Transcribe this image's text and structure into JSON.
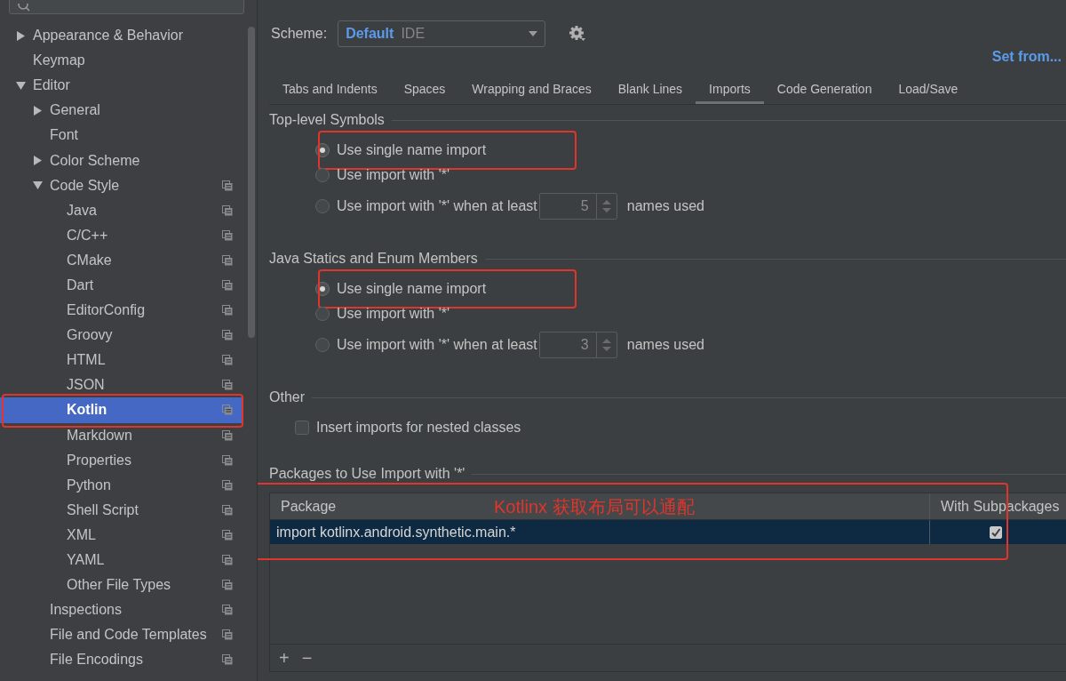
{
  "sidebar": {
    "tree": [
      {
        "label": "Appearance & Behavior",
        "expanded": false,
        "selected": false,
        "scoped": false,
        "annotated": false
      },
      {
        "label": "Keymap",
        "selected": false,
        "scoped": false,
        "annotated": false
      },
      {
        "label": "Editor",
        "expanded": true,
        "selected": false,
        "scoped": false,
        "annotated": false,
        "children": [
          {
            "label": "General",
            "expanded": false,
            "selected": false,
            "scoped": false,
            "annotated": false
          },
          {
            "label": "Font",
            "selected": false,
            "scoped": false,
            "annotated": false
          },
          {
            "label": "Color Scheme",
            "expanded": false,
            "selected": false,
            "scoped": false,
            "annotated": false
          },
          {
            "label": "Code Style",
            "expanded": true,
            "selected": false,
            "scoped": true,
            "annotated": false,
            "children": [
              {
                "label": "Java",
                "selected": false,
                "scoped": true,
                "annotated": false
              },
              {
                "label": "C/C++",
                "selected": false,
                "scoped": true,
                "annotated": false
              },
              {
                "label": "CMake",
                "selected": false,
                "scoped": true,
                "annotated": false
              },
              {
                "label": "Dart",
                "selected": false,
                "scoped": true,
                "annotated": false
              },
              {
                "label": "EditorConfig",
                "selected": false,
                "scoped": true,
                "annotated": false
              },
              {
                "label": "Groovy",
                "selected": false,
                "scoped": true,
                "annotated": false
              },
              {
                "label": "HTML",
                "selected": false,
                "scoped": true,
                "annotated": false
              },
              {
                "label": "JSON",
                "selected": false,
                "scoped": true,
                "annotated": false
              },
              {
                "label": "Kotlin",
                "selected": true,
                "scoped": true,
                "annotated": true
              },
              {
                "label": "Markdown",
                "selected": false,
                "scoped": true,
                "annotated": false
              },
              {
                "label": "Properties",
                "selected": false,
                "scoped": true,
                "annotated": false
              },
              {
                "label": "Python",
                "selected": false,
                "scoped": true,
                "annotated": false
              },
              {
                "label": "Shell Script",
                "selected": false,
                "scoped": true,
                "annotated": false
              },
              {
                "label": "XML",
                "selected": false,
                "scoped": true,
                "annotated": false
              },
              {
                "label": "YAML",
                "selected": false,
                "scoped": true,
                "annotated": false
              },
              {
                "label": "Other File Types",
                "selected": false,
                "scoped": true,
                "annotated": false
              }
            ]
          },
          {
            "label": "Inspections",
            "selected": false,
            "scoped": true,
            "annotated": false
          },
          {
            "label": "File and Code Templates",
            "selected": false,
            "scoped": true,
            "annotated": false
          },
          {
            "label": "File Encodings",
            "selected": false,
            "scoped": true,
            "annotated": false
          }
        ]
      }
    ]
  },
  "scheme": {
    "label": "Scheme:",
    "name": "Default",
    "scope": "IDE"
  },
  "set_from_link": "Set from...",
  "tabs": [
    {
      "label": "Tabs and Indents",
      "selected": false
    },
    {
      "label": "Spaces",
      "selected": false
    },
    {
      "label": "Wrapping and Braces",
      "selected": false
    },
    {
      "label": "Blank Lines",
      "selected": false
    },
    {
      "label": "Imports",
      "selected": true
    },
    {
      "label": "Code Generation",
      "selected": false
    },
    {
      "label": "Load/Save",
      "selected": false
    }
  ],
  "sections": [
    {
      "kind": "radio_group",
      "title": "Top-level Symbols",
      "options": [
        {
          "label": "Use single name import",
          "selected": true,
          "annotated": true
        },
        {
          "label": "Use import with '*'",
          "selected": false
        },
        {
          "label": "Use import with '*' when at least",
          "selected": false,
          "count": "5",
          "suffix": "names used"
        }
      ]
    },
    {
      "kind": "radio_group",
      "title": "Java Statics and Enum Members",
      "options": [
        {
          "label": "Use single name import",
          "selected": true,
          "annotated": true
        },
        {
          "label": "Use import with '*'",
          "selected": false
        },
        {
          "label": "Use import with '*' when at least",
          "selected": false,
          "count": "3",
          "suffix": "names used"
        }
      ]
    },
    {
      "kind": "checkbox_group",
      "title": "Other",
      "options": [
        {
          "label": "Insert imports for nested classes",
          "checked": false
        }
      ]
    },
    {
      "kind": "table",
      "title": "Packages to Use Import with '*'",
      "annotation": "Kotlinx 获取布局可以通配",
      "columns": [
        "Package",
        "With Subpackages"
      ],
      "rows": [
        {
          "package": "import kotlinx.android.synthetic.main.*",
          "with_subpackages": true,
          "selected": true
        }
      ],
      "toolbar": [
        "+",
        "−"
      ]
    }
  ]
}
